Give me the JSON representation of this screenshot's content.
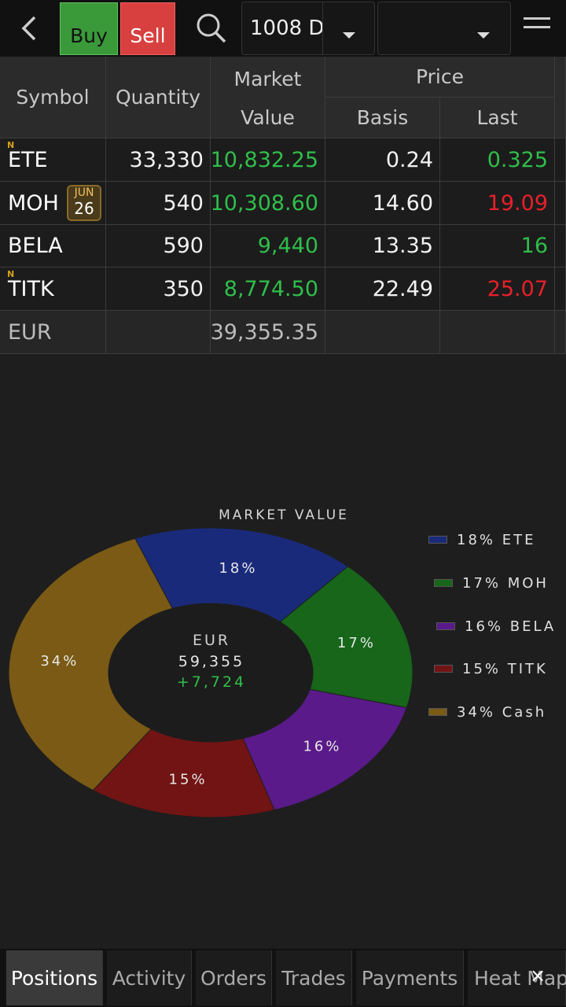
{
  "toolbar": {
    "buy_label": "Buy",
    "sell_label": "Sell",
    "account_value": "1008 D",
    "second_value": ""
  },
  "table": {
    "headers": {
      "symbol": "Symbol",
      "quantity": "Quantity",
      "market": "Market",
      "value": "Value",
      "price": "Price",
      "basis": "Basis",
      "last": "Last"
    },
    "rows": [
      {
        "symbol": "ETE",
        "badge": "N",
        "quantity": "33,330",
        "market_value": "10,832.25",
        "basis": "0.24",
        "last": "0.325",
        "last_color": "green"
      },
      {
        "symbol": "MOH",
        "calendar_month": "JUN",
        "calendar_day": "26",
        "quantity": "540",
        "market_value": "10,308.60",
        "basis": "14.60",
        "last": "19.09",
        "last_color": "red"
      },
      {
        "symbol": "BELA",
        "quantity": "590",
        "market_value": "9,440",
        "basis": "13.35",
        "last": "16",
        "last_color": "green"
      },
      {
        "symbol": "TITK",
        "badge": "N",
        "quantity": "350",
        "market_value": "8,774.50",
        "basis": "22.49",
        "last": "25.07",
        "last_color": "red"
      }
    ],
    "total": {
      "currency": "EUR",
      "market_value": "39,355.35"
    }
  },
  "chart_data": {
    "type": "pie",
    "title": "Market Value",
    "center": {
      "currency": "EUR",
      "total": "59,355",
      "change": "+7,724"
    },
    "slices": [
      {
        "label": "ETE",
        "percent": 18,
        "legend": "18% ETE",
        "color": "#1a2a7a"
      },
      {
        "label": "MOH",
        "percent": 17,
        "legend": "17% MOH",
        "color": "#17661a"
      },
      {
        "label": "BELA",
        "percent": 16,
        "legend": "16% BELA",
        "color": "#5a1a8a"
      },
      {
        "label": "TITK",
        "percent": 15,
        "legend": "15% TITK",
        "color": "#721414"
      },
      {
        "label": "Cash",
        "percent": 34,
        "legend": "34% Cash",
        "color": "#7a5a14"
      }
    ]
  },
  "tabs": [
    {
      "label": "Positions",
      "active": true
    },
    {
      "label": "Activity"
    },
    {
      "label": "Orders"
    },
    {
      "label": "Trades"
    },
    {
      "label": "Payments"
    },
    {
      "label": "Heat Map"
    }
  ],
  "colors": {
    "green": "#2fbf4a",
    "red": "#e8202a"
  }
}
